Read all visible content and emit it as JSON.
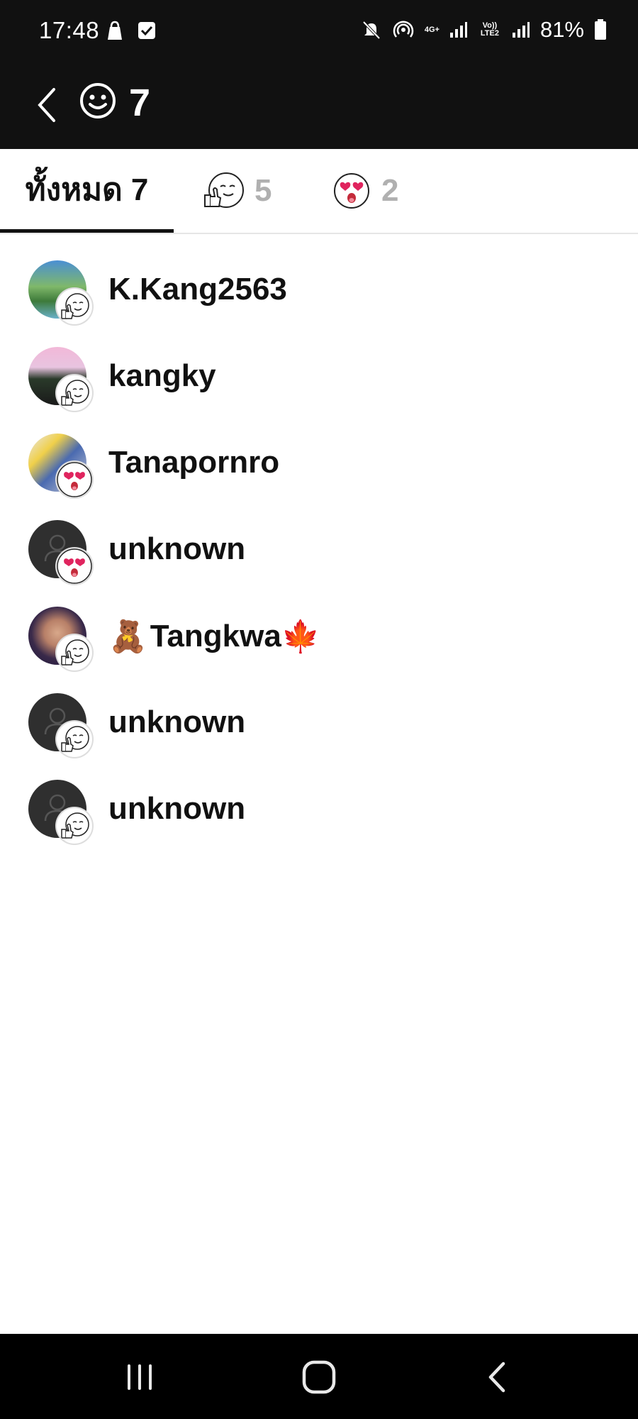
{
  "status_bar": {
    "time": "17:48",
    "battery_percent": "81%",
    "network_top": "4G+",
    "network_volte": "Vo)) LTE2",
    "icons": [
      "notification-bag-icon",
      "checkbox-icon",
      "mute-icon",
      "hotspot-icon",
      "signal-icon",
      "battery-icon"
    ]
  },
  "header": {
    "reaction_icon": "smile-icon",
    "count": "7"
  },
  "tabs": [
    {
      "label": "ทั้งหมด 7",
      "selected": true
    },
    {
      "icon": "thumbs-up-emoji-icon",
      "count": "5"
    },
    {
      "icon": "heart-eyes-emoji-icon",
      "count": "2"
    }
  ],
  "users": [
    {
      "name": "K.Kang2563",
      "reaction": "thumbs-up",
      "avatar": "landscape-photo"
    },
    {
      "name": "kangky",
      "reaction": "thumbs-up",
      "avatar": "green-screen-photo"
    },
    {
      "name": "Tanapornro",
      "reaction": "heart-eyes",
      "avatar": "colorful-photo"
    },
    {
      "name": "unknown",
      "reaction": "heart-eyes",
      "avatar": "default-user"
    },
    {
      "name": "Tangkwa",
      "prefix_emoji": "🧸",
      "suffix_emoji": "🍁",
      "reaction": "thumbs-up",
      "avatar": "selfie-photo"
    },
    {
      "name": "unknown",
      "reaction": "thumbs-up",
      "avatar": "default-user"
    },
    {
      "name": "unknown",
      "reaction": "thumbs-up",
      "avatar": "default-user"
    }
  ],
  "nav_bar": {
    "icons": [
      "recent-apps-icon",
      "home-icon",
      "back-nav-icon"
    ]
  },
  "colors": {
    "header_bg": "#111111",
    "text_primary": "#111111",
    "tab_inactive": "#b0b0b0",
    "heart_red": "#e0245e"
  }
}
